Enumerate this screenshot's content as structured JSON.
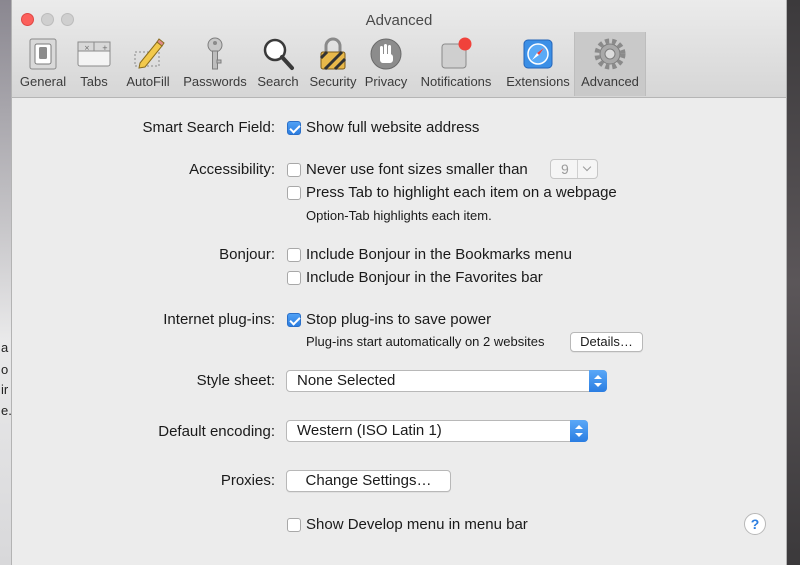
{
  "window": {
    "title": "Advanced"
  },
  "toolbar": {
    "tabs": [
      {
        "label": "General",
        "icon": "general-switch-icon"
      },
      {
        "label": "Tabs",
        "icon": "tabs-icon"
      },
      {
        "label": "AutoFill",
        "icon": "pencil-icon"
      },
      {
        "label": "Passwords",
        "icon": "key-icon"
      },
      {
        "label": "Search",
        "icon": "magnifier-icon"
      },
      {
        "label": "Security",
        "icon": "padlock-icon"
      },
      {
        "label": "Privacy",
        "icon": "hand-icon"
      },
      {
        "label": "Notifications",
        "icon": "notification-badge-icon"
      },
      {
        "label": "Extensions",
        "icon": "compass-icon"
      },
      {
        "label": "Advanced",
        "icon": "gear-icon",
        "selected": true
      }
    ]
  },
  "settings": {
    "smart_search": {
      "label": "Smart Search Field:",
      "option": {
        "text": "Show full website address",
        "checked": true
      }
    },
    "accessibility": {
      "label": "Accessibility:",
      "font_size_option": {
        "text": "Never use font sizes smaller than",
        "checked": false
      },
      "font_size_value": "9",
      "tab_option": {
        "text": "Press Tab to highlight each item on a webpage",
        "checked": false
      },
      "tab_note": "Option-Tab highlights each item."
    },
    "bonjour": {
      "label": "Bonjour:",
      "bookmarks_option": {
        "text": "Include Bonjour in the Bookmarks menu",
        "checked": false
      },
      "favorites_option": {
        "text": "Include Bonjour in the Favorites bar",
        "checked": false
      }
    },
    "plugins": {
      "label": "Internet plug-ins:",
      "option": {
        "text": "Stop plug-ins to save power",
        "checked": true
      },
      "note": "Plug-ins start automatically on 2 websites",
      "details_button": "Details…"
    },
    "style_sheet": {
      "label": "Style sheet:",
      "value": "None Selected"
    },
    "encoding": {
      "label": "Default encoding:",
      "value": "Western (ISO Latin 1)"
    },
    "proxies": {
      "label": "Proxies:",
      "button": "Change Settings…"
    },
    "develop": {
      "option": {
        "text": "Show Develop menu in menu bar",
        "checked": false
      }
    },
    "help_button": "?"
  },
  "background": {
    "left_fragments": [
      "a",
      "o",
      "ir",
      "e."
    ]
  },
  "colors": {
    "accent": "#2b7de0",
    "close_button": "#fc605c",
    "window_bg": "#ececec"
  }
}
